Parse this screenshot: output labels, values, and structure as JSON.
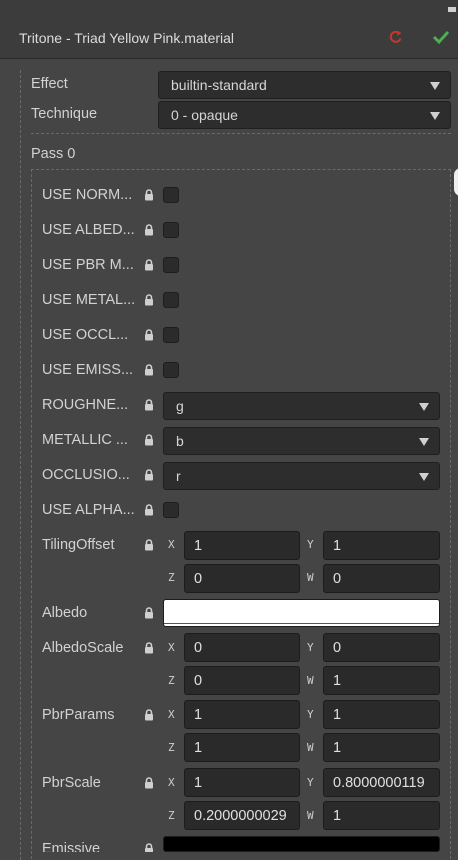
{
  "header": {
    "title": "Tritone - Triad Yellow Pink.material"
  },
  "effect": {
    "label": "Effect",
    "value": "builtin-standard"
  },
  "technique": {
    "label": "Technique",
    "value": "0 - opaque"
  },
  "pass": {
    "label": "Pass 0"
  },
  "defines": [
    {
      "label": "USE NORM...",
      "checked": false
    },
    {
      "label": "USE ALBED...",
      "checked": false
    },
    {
      "label": "USE PBR M...",
      "checked": false
    },
    {
      "label": "USE METAL...",
      "checked": false
    },
    {
      "label": "USE OCCL...",
      "checked": false
    },
    {
      "label": "USE EMISS...",
      "checked": false
    }
  ],
  "channels": [
    {
      "label": "ROUGHNE...",
      "value": "g"
    },
    {
      "label": "METALLIC ...",
      "value": "b"
    },
    {
      "label": "OCCLUSIO...",
      "value": "r"
    }
  ],
  "use_alpha": {
    "label": "USE ALPHA...",
    "checked": false
  },
  "props": [
    {
      "label": "TilingOffset",
      "x": "1",
      "y": "1",
      "z": "0",
      "w": "0"
    },
    {
      "label": "AlbedoScale",
      "x": "0",
      "y": "0",
      "z": "0",
      "w": "1"
    },
    {
      "label": "PbrParams",
      "x": "1",
      "y": "1",
      "z": "1",
      "w": "1"
    },
    {
      "label": "PbrScale",
      "x": "1",
      "y": "0.8000000119",
      "z": "0.2000000029",
      "w": "1"
    }
  ],
  "albedo": {
    "label": "Albedo",
    "color": "#ffffff"
  },
  "emissive": {
    "label": "Emissive",
    "color": "#000000"
  },
  "axes": {
    "x": "X",
    "y": "Y",
    "z": "Z",
    "w": "W"
  },
  "colors": {
    "revert": "#c0392b",
    "apply": "#4caf50"
  },
  "icons": {
    "revert": "revert-icon",
    "apply": "checkmark-icon",
    "lock": "lock-icon"
  }
}
